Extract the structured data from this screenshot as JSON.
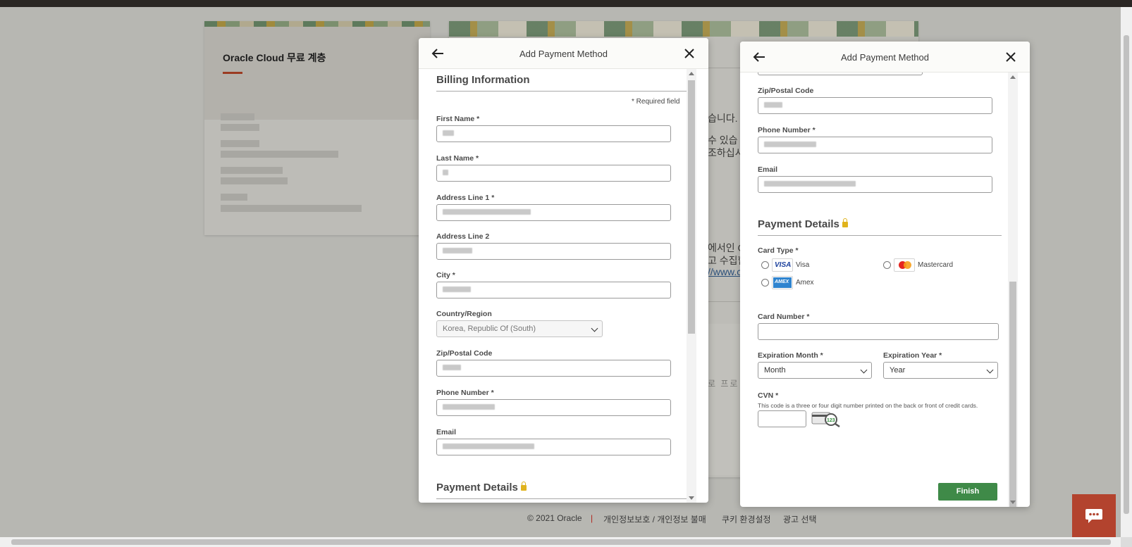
{
  "background": {
    "card1_title": "Oracle Cloud 무료 계층",
    "text_fragments": [
      "습니다.",
      "수 있습",
      "조하십시",
      "에서인 C",
      "고 수집합",
      "//www.c",
      "로 프로"
    ]
  },
  "modal_left": {
    "title": "Add Payment Method",
    "billing_title": "Billing Information",
    "required_note": "* Required field",
    "first_name_label": "First Name *",
    "last_name_label": "Last Name *",
    "address1_label": "Address Line 1 *",
    "address2_label": "Address Line 2",
    "city_label": "City *",
    "country_label": "Country/Region",
    "country_value": "Korea, Republic Of (South)",
    "zip_label": "Zip/Postal Code",
    "phone_label": "Phone Number *",
    "email_label": "Email",
    "payment_title": "Payment Details"
  },
  "modal_right": {
    "title": "Add Payment Method",
    "zip_label": "Zip/Postal Code",
    "phone_label": "Phone Number *",
    "email_label": "Email",
    "payment_title": "Payment Details",
    "card_type_label": "Card Type *",
    "card_types": [
      {
        "name": "Visa",
        "logo": "visa-logo"
      },
      {
        "name": "Mastercard",
        "logo": "mastercard-logo"
      },
      {
        "name": "Amex",
        "logo": "amex-logo"
      }
    ],
    "card_number_label": "Card Number *",
    "card_number_value": "",
    "exp_month_label": "Expiration Month *",
    "exp_month_value": "Month",
    "exp_year_label": "Expiration Year *",
    "exp_year_value": "Year",
    "cvn_label": "CVN *",
    "cvn_note": "This code is a three or four digit number printed on the back or front of credit cards.",
    "cvn_icon_text": "123",
    "finish_label": "Finish"
  },
  "footer": {
    "copyright": "© 2021 Oracle",
    "separator": "|",
    "privacy": "개인정보보호 / 개인정보 불매",
    "cookies": "쿠키 환경설정",
    "ads": "광고 선택"
  },
  "colors": {
    "finish_button": "#3f8a48",
    "chat_button": "#b3432e",
    "accent_underline": "#9b3b22"
  }
}
